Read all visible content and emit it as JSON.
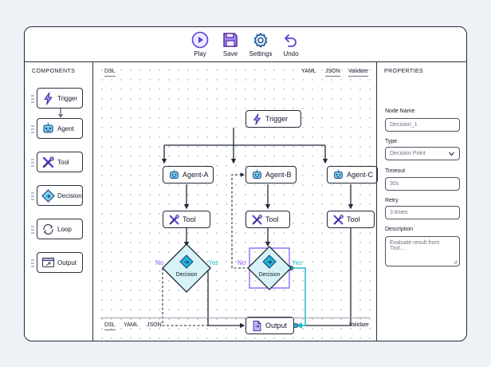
{
  "toolbar": {
    "buttons": [
      {
        "label": "Play",
        "icon": "play-icon"
      },
      {
        "label": "Save",
        "icon": "save-icon"
      },
      {
        "label": "Settings",
        "icon": "gear-icon"
      },
      {
        "label": "Undo",
        "icon": "undo-icon"
      }
    ]
  },
  "components": {
    "title": "COMPONENTS",
    "items": [
      {
        "label": "Trigger",
        "icon": "lightning-icon"
      },
      {
        "label": "Agent",
        "icon": "robot-icon"
      },
      {
        "label": "Tool",
        "icon": "wrench-screwdriver-icon"
      },
      {
        "label": "Decision",
        "icon": "decision-diamond-icon"
      },
      {
        "label": "Loop",
        "icon": "loop-icon"
      },
      {
        "label": "Output",
        "icon": "output-window-icon"
      }
    ]
  },
  "canvas": {
    "top_tabs": {
      "dsl": "DSL",
      "yaml": "YAML",
      "json": "JSON",
      "validate": "Validate"
    },
    "bottom_tabs": {
      "dsl": "DSL",
      "yaml": "YAML",
      "json": "JSON",
      "validate": "Validate"
    },
    "nodes": {
      "trigger": "Trigger",
      "agent_a": "Agent-A",
      "agent_b": "Agent-B",
      "agent_c": "Agent-C",
      "tool_a": "Tool",
      "tool_b": "Tool",
      "tool_c": "Tool",
      "decision_1": "Decision",
      "decision_2": "Decision",
      "output": "Output"
    },
    "edge_labels": {
      "no_1": "No",
      "yes_1": "Yes",
      "no_2": "No",
      "yes_2": "Yes"
    },
    "colors": {
      "accent_purple": "#8b5cf6",
      "accent_cyan": "#22b8cf",
      "decision_fill": "#d8f3f8"
    }
  },
  "properties": {
    "title": "PROPERTIES",
    "node_name": {
      "label": "Node Name",
      "value": "Decision_1"
    },
    "type": {
      "label": "Type",
      "value": "Decision Point"
    },
    "timeout": {
      "label": "Timeout",
      "value": "30s"
    },
    "retry": {
      "label": "Retry",
      "value": "3 times"
    },
    "description": {
      "label": "Description",
      "placeholder": "Evaluate result from Tool..."
    }
  }
}
